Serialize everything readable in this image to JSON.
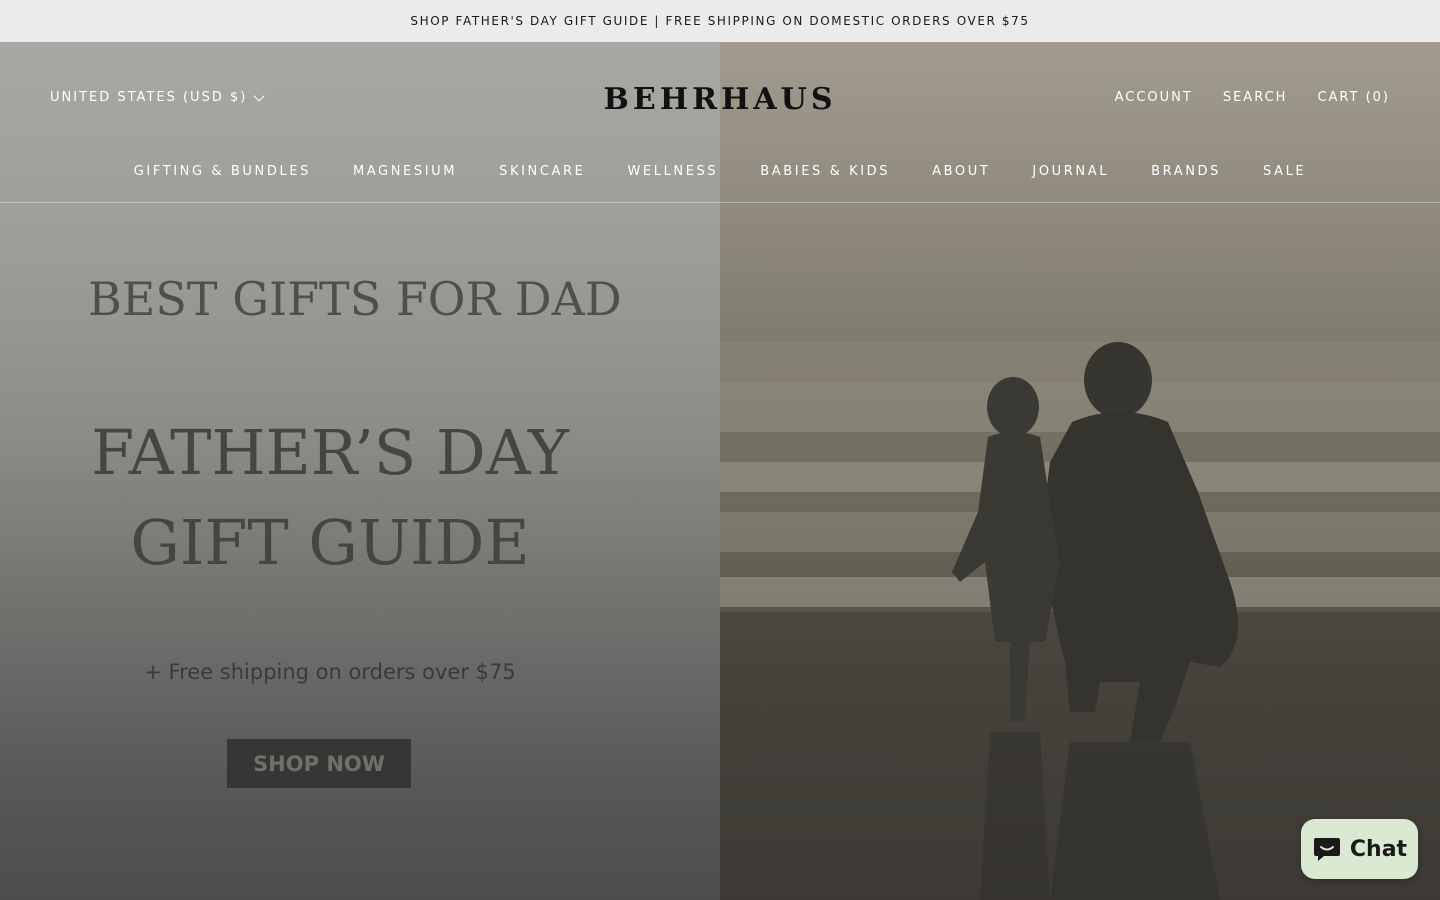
{
  "announcement": "SHOP FATHER'S DAY GIFT GUIDE | FREE SHIPPING ON DOMESTIC ORDERS OVER $75",
  "header": {
    "locale": "UNITED STATES (USD $)",
    "logo": "BEHRHAUS",
    "account": "ACCOUNT",
    "search": "SEARCH",
    "cart": "CART (0)"
  },
  "nav": {
    "items": [
      {
        "label": "GIFTING & BUNDLES"
      },
      {
        "label": "MAGNESIUM"
      },
      {
        "label": "SKINCARE"
      },
      {
        "label": "WELLNESS"
      },
      {
        "label": "BABIES & KIDS"
      },
      {
        "label": "ABOUT"
      },
      {
        "label": "JOURNAL"
      },
      {
        "label": "BRANDS"
      },
      {
        "label": "SALE"
      }
    ]
  },
  "hero": {
    "kicker": "BEST GIFTS FOR DAD",
    "title_line1": "FATHER’S DAY",
    "title_line2": "GIFT GUIDE",
    "subtitle": "+ Free shipping on orders over $75",
    "cta": "SHOP NOW"
  },
  "chat": {
    "label": "Chat",
    "icon": "chat-bubble-icon"
  },
  "colors": {
    "announcement_bg": "#ebebeb",
    "chat_bg": "#dbe9d3",
    "cta_bg": "#363634"
  }
}
